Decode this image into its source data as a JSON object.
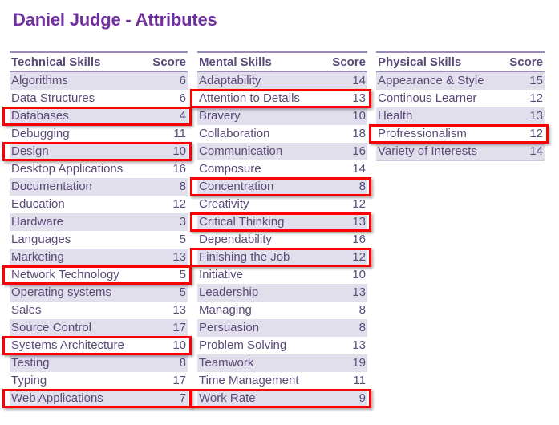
{
  "title": "Daniel Judge - Attributes",
  "colors": {
    "title": "#7030a0",
    "text": "#5a4a78",
    "row_shade": "#e2dfec",
    "highlight": "#ff0000"
  },
  "tables": [
    {
      "header": "Technical Skills",
      "score_header": "Score",
      "rows": [
        {
          "name": "Algorithms",
          "score": "6"
        },
        {
          "name": "Data Structures",
          "score": "6"
        },
        {
          "name": "Databases",
          "score": "4",
          "highlighted": true
        },
        {
          "name": "Debugging",
          "score": "11"
        },
        {
          "name": "Design",
          "score": "10",
          "highlighted": true
        },
        {
          "name": "Desktop Applications",
          "score": "16"
        },
        {
          "name": "Documentation",
          "score": "8"
        },
        {
          "name": "Education",
          "score": "12"
        },
        {
          "name": "Hardware",
          "score": "3"
        },
        {
          "name": "Languages",
          "score": "5"
        },
        {
          "name": "Marketing",
          "score": "13"
        },
        {
          "name": "Network Technology",
          "score": "5",
          "highlighted": true
        },
        {
          "name": "Operating systems",
          "score": "5"
        },
        {
          "name": "Sales",
          "score": "13"
        },
        {
          "name": "Source Control",
          "score": "17"
        },
        {
          "name": "Systems Architecture",
          "score": "10",
          "highlighted": true
        },
        {
          "name": "Testing",
          "score": "8"
        },
        {
          "name": "Typing",
          "score": "17"
        },
        {
          "name": "Web Applications",
          "score": "7",
          "highlighted": true
        }
      ]
    },
    {
      "header": "Mental Skills",
      "score_header": "Score",
      "rows": [
        {
          "name": "Adaptability",
          "score": "14"
        },
        {
          "name": "Attention to Details",
          "score": "13",
          "highlighted": true
        },
        {
          "name": "Bravery",
          "score": "10"
        },
        {
          "name": "Collaboration",
          "score": "18"
        },
        {
          "name": "Communication",
          "score": "16"
        },
        {
          "name": "Composure",
          "score": "14"
        },
        {
          "name": "Concentration",
          "score": "8",
          "highlighted": true
        },
        {
          "name": "Creativity",
          "score": "12"
        },
        {
          "name": "Critical Thinking",
          "score": "13",
          "highlighted": true
        },
        {
          "name": "Dependability",
          "score": "16"
        },
        {
          "name": "Finishing the Job",
          "score": "12",
          "highlighted": true
        },
        {
          "name": "Initiative",
          "score": "10"
        },
        {
          "name": "Leadership",
          "score": "13"
        },
        {
          "name": "Managing",
          "score": "8"
        },
        {
          "name": "Persuasion",
          "score": "8"
        },
        {
          "name": "Problem Solving",
          "score": "13"
        },
        {
          "name": "Teamwork",
          "score": "19"
        },
        {
          "name": "Time Management",
          "score": "11"
        },
        {
          "name": "Work Rate",
          "score": "9",
          "highlighted": true
        }
      ]
    },
    {
      "header": "Physical Skills",
      "score_header": "Score",
      "rows": [
        {
          "name": "Appearance & Style",
          "score": "15"
        },
        {
          "name": "Continous Learner",
          "score": "12"
        },
        {
          "name": "Health",
          "score": "13"
        },
        {
          "name": "Profressionalism",
          "score": "12",
          "highlighted": true
        },
        {
          "name": "Variety of Interests",
          "score": "14"
        }
      ]
    }
  ]
}
